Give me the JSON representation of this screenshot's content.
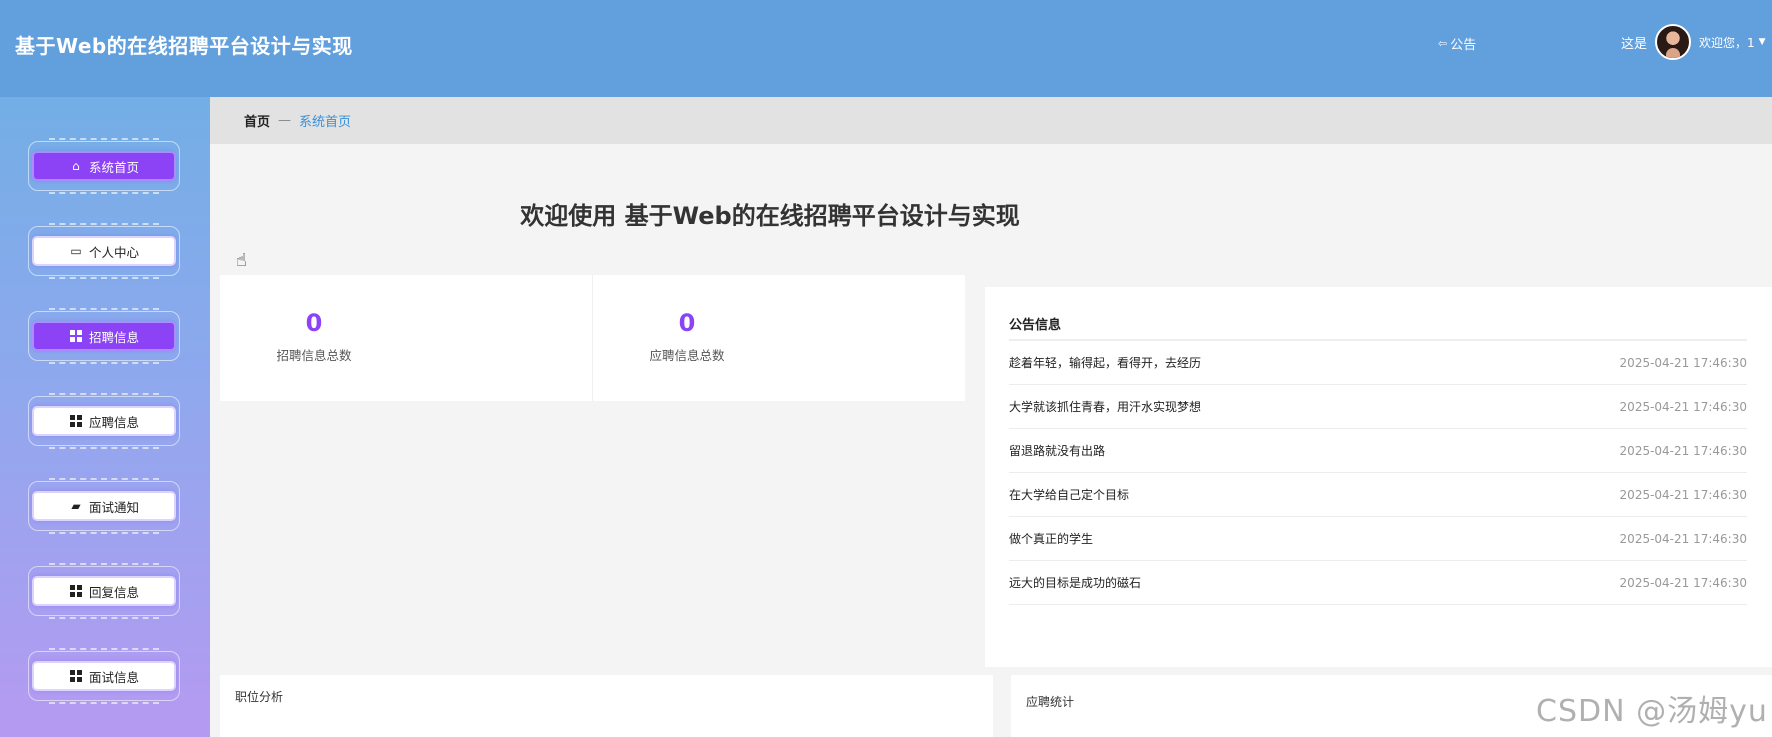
{
  "header": {
    "app_title": "基于Web的在线招聘平台设计与实现",
    "notice_link": "公告",
    "user_prefix": "这是",
    "welcome": "欢迎您，1"
  },
  "breadcrumb": {
    "home": "首页",
    "separator": "—",
    "current": "系统首页"
  },
  "sidebar": {
    "items": [
      {
        "label": "系统首页",
        "icon": "home-icon",
        "active": true
      },
      {
        "label": "个人中心",
        "icon": "card-icon",
        "active": false
      },
      {
        "label": "招聘信息",
        "icon": "grid-icon",
        "active": true
      },
      {
        "label": "应聘信息",
        "icon": "grid-icon",
        "active": false
      },
      {
        "label": "面试通知",
        "icon": "briefcase-icon",
        "active": false
      },
      {
        "label": "回复信息",
        "icon": "grid-icon",
        "active": false
      },
      {
        "label": "面试信息",
        "icon": "grid-icon",
        "active": false
      }
    ]
  },
  "main": {
    "welcome_title": "欢迎使用 基于Web的在线招聘平台设计与实现",
    "stats": [
      {
        "value": "0",
        "label": "招聘信息总数"
      },
      {
        "value": "0",
        "label": "应聘信息总数"
      }
    ],
    "notices": {
      "title": "公告信息",
      "items": [
        {
          "title": "趁着年轻，输得起，看得开，去经历",
          "date": "2025-04-21 17:46:30"
        },
        {
          "title": "大学就该抓住青春，用汗水实现梦想",
          "date": "2025-04-21 17:46:30"
        },
        {
          "title": "留退路就没有出路",
          "date": "2025-04-21 17:46:30"
        },
        {
          "title": "在大学给自己定个目标",
          "date": "2025-04-21 17:46:30"
        },
        {
          "title": "做个真正的学生",
          "date": "2025-04-21 17:46:30"
        },
        {
          "title": "远大的目标是成功的磁石",
          "date": "2025-04-21 17:46:30"
        }
      ]
    },
    "job_analysis_title": "职位分析",
    "application_stats_title": "应聘统计"
  },
  "watermark": "CSDN @汤姆yu",
  "colors": {
    "header": "#629fdd",
    "accent": "#8b43f5",
    "link": "#3a8fd6"
  }
}
